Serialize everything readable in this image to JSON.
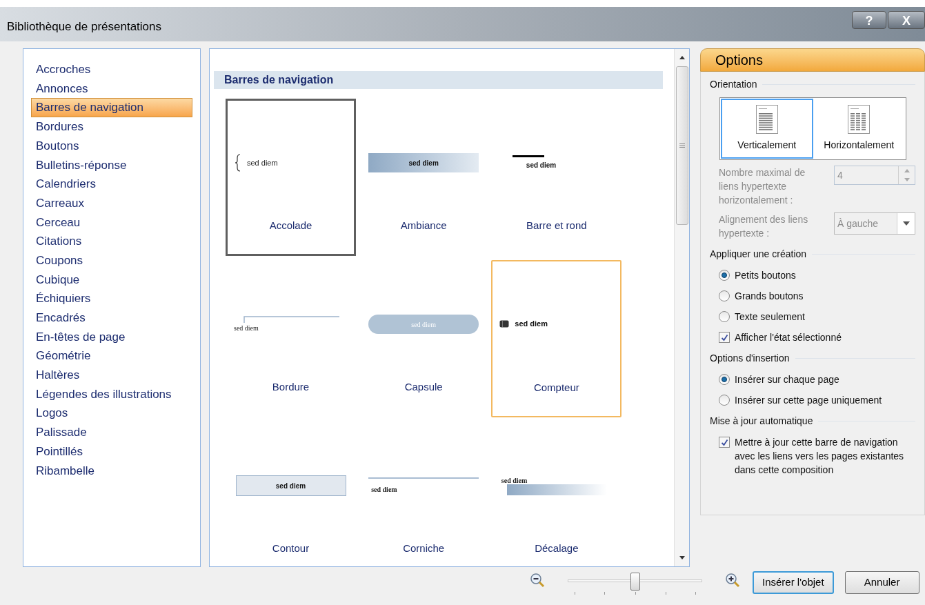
{
  "window": {
    "title": "Bibliothèque de présentations",
    "help_button": "?",
    "close_button": "X"
  },
  "categories": [
    {
      "label": "Accroches",
      "selected": false
    },
    {
      "label": "Annonces",
      "selected": false
    },
    {
      "label": "Barres de navigation",
      "selected": true
    },
    {
      "label": "Bordures",
      "selected": false
    },
    {
      "label": "Boutons",
      "selected": false
    },
    {
      "label": "Bulletins-réponse",
      "selected": false
    },
    {
      "label": "Calendriers",
      "selected": false
    },
    {
      "label": "Carreaux",
      "selected": false
    },
    {
      "label": "Cerceau",
      "selected": false
    },
    {
      "label": "Citations",
      "selected": false
    },
    {
      "label": "Coupons",
      "selected": false
    },
    {
      "label": "Cubique",
      "selected": false
    },
    {
      "label": "Échiquiers",
      "selected": false
    },
    {
      "label": "Encadrés",
      "selected": false
    },
    {
      "label": "En-têtes de page",
      "selected": false
    },
    {
      "label": "Géométrie",
      "selected": false
    },
    {
      "label": "Haltères",
      "selected": false
    },
    {
      "label": "Légendes des illustrations",
      "selected": false
    },
    {
      "label": "Logos",
      "selected": false
    },
    {
      "label": "Palissade",
      "selected": false
    },
    {
      "label": "Pointillés",
      "selected": false
    },
    {
      "label": "Ribambelle",
      "selected": false
    }
  ],
  "gallery": {
    "heading": "Barres de navigation",
    "items": [
      {
        "label": "Accolade",
        "kind": "accolade",
        "preview_text": "sed diem",
        "selected": true,
        "hovered": false
      },
      {
        "label": "Ambiance",
        "kind": "ambiance",
        "preview_text": "sed diem",
        "selected": false,
        "hovered": false
      },
      {
        "label": "Barre et rond",
        "kind": "barre",
        "preview_text": "sed diem",
        "selected": false,
        "hovered": false
      },
      {
        "label": "Bordure",
        "kind": "bordure",
        "preview_text": "sed diem",
        "selected": false,
        "hovered": false
      },
      {
        "label": "Capsule",
        "kind": "capsule",
        "preview_text": "sed diem",
        "selected": false,
        "hovered": false
      },
      {
        "label": "Compteur",
        "kind": "compteur",
        "preview_text": "sed diem",
        "selected": false,
        "hovered": true
      },
      {
        "label": "Contour",
        "kind": "contour",
        "preview_text": "sed diem",
        "selected": false,
        "hovered": false
      },
      {
        "label": "Corniche",
        "kind": "corniche",
        "preview_text": "sed diem",
        "selected": false,
        "hovered": false
      },
      {
        "label": "Décalage",
        "kind": "decalage",
        "preview_text": "sed diem",
        "selected": false,
        "hovered": false
      }
    ]
  },
  "options": {
    "title": "Options",
    "orientation": {
      "heading": "Orientation",
      "choices": [
        {
          "label": "Verticalement",
          "kind": "vertical",
          "selected": true
        },
        {
          "label": "Horizontalement",
          "kind": "horizontal",
          "selected": false
        }
      ]
    },
    "max_links": {
      "label": "Nombre maximal de liens hypertexte horizontalement :",
      "value": "4",
      "disabled": true
    },
    "alignment": {
      "label": "Alignement des liens hypertexte :",
      "value": "À gauche",
      "disabled": true
    },
    "groups": [
      {
        "heading": "Appliquer une création",
        "controls": [
          {
            "kind": "radio",
            "label": "Petits boutons",
            "checked": true
          },
          {
            "kind": "radio",
            "label": "Grands boutons",
            "checked": false
          },
          {
            "kind": "radio",
            "label": "Texte seulement",
            "checked": false
          },
          {
            "kind": "checkbox",
            "label": "Afficher l'état sélectionné",
            "checked": true
          }
        ]
      },
      {
        "heading": "Options d'insertion",
        "controls": [
          {
            "kind": "radio",
            "label": "Insérer sur chaque page",
            "checked": true
          },
          {
            "kind": "radio",
            "label": "Insérer sur cette page uniquement",
            "checked": false
          }
        ]
      },
      {
        "heading": "Mise à jour automatique",
        "controls": [
          {
            "kind": "checkbox",
            "label": "Mettre à jour cette barre de navigation avec les liens vers les pages existantes dans cette composition",
            "checked": true
          }
        ]
      }
    ]
  },
  "zoom": {
    "level": 0.5
  },
  "buttons": [
    {
      "label": "Insérer l'objet",
      "default": true
    },
    {
      "label": "Annuler",
      "default": false
    }
  ]
}
